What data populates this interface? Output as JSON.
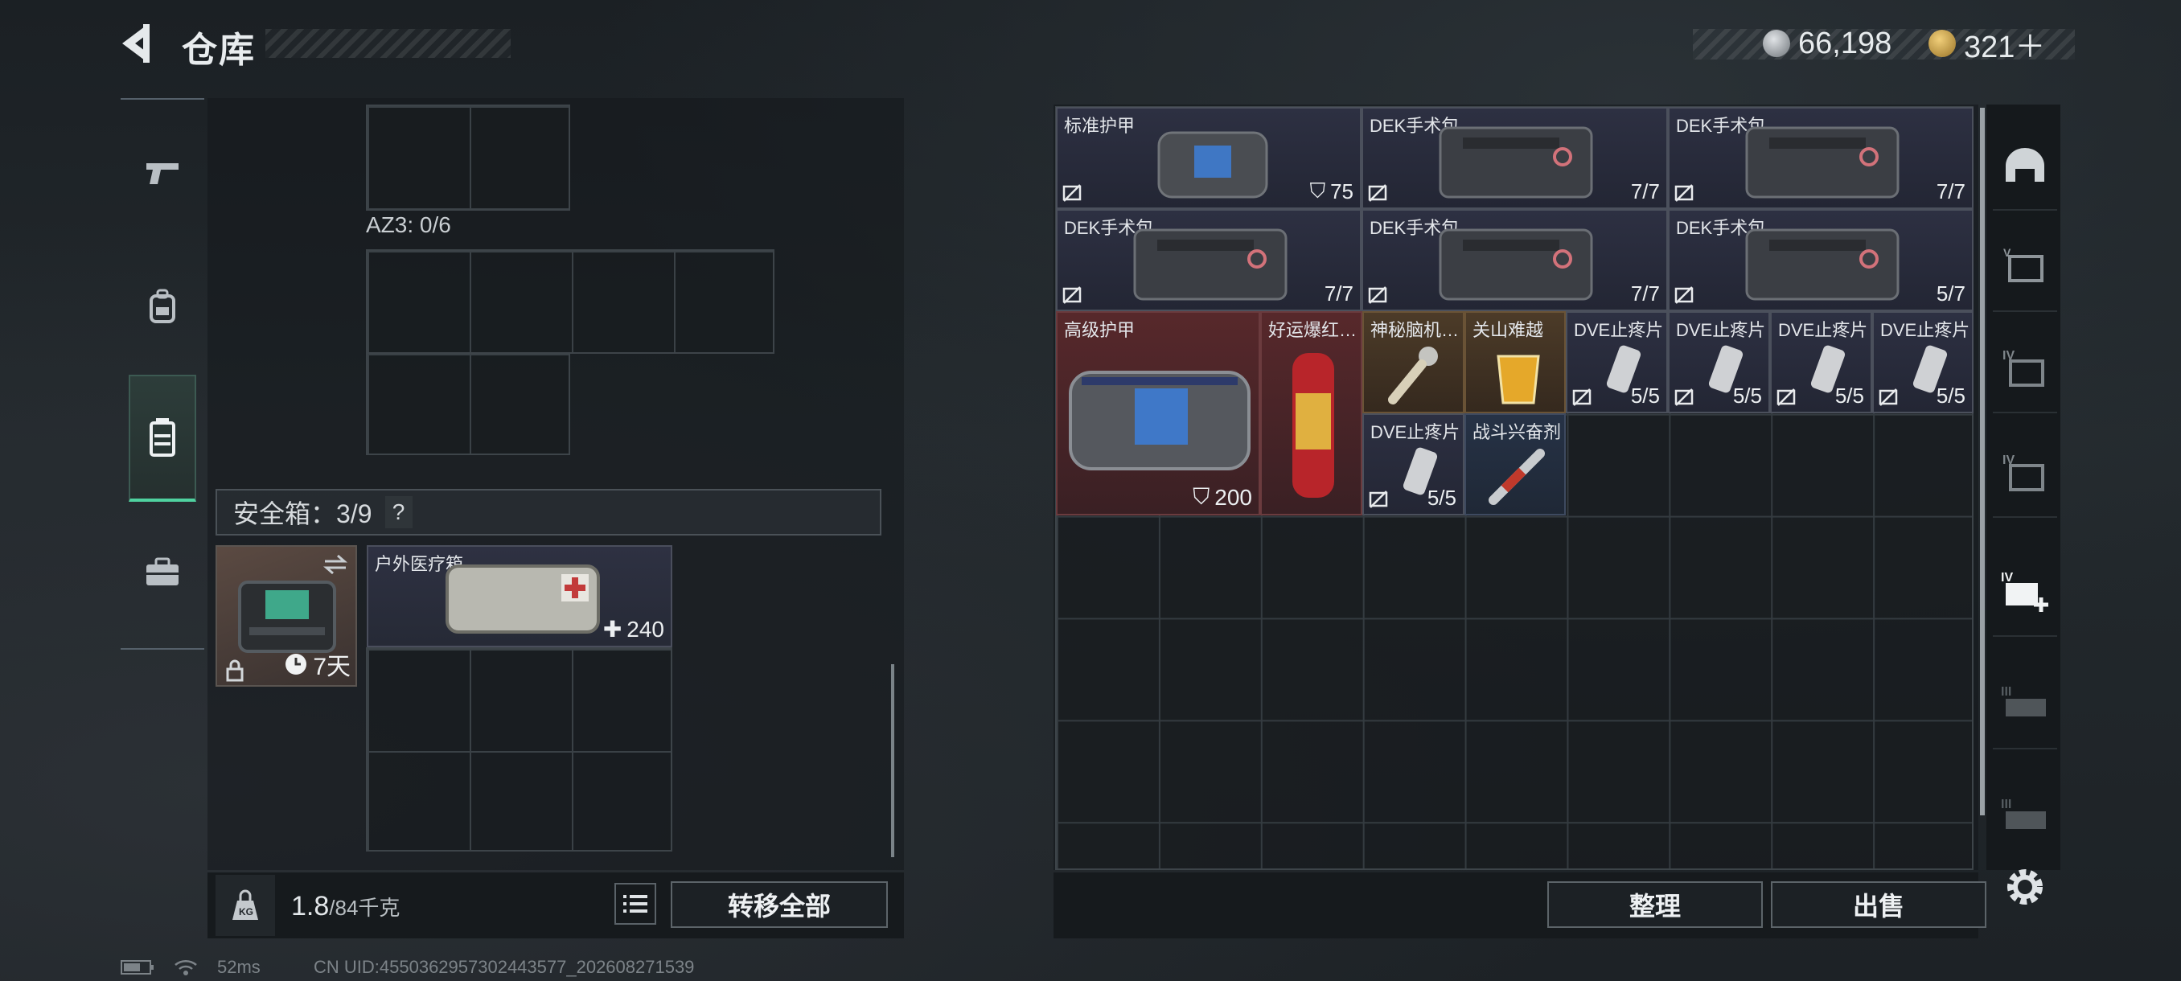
{
  "header": {
    "title": "仓库",
    "currency": [
      {
        "icon": "silver-coin-icon",
        "value": "66,198"
      },
      {
        "icon": "gold-triangle-coin-icon",
        "value": "321＋"
      }
    ]
  },
  "left_nav": [
    {
      "icon": "pistol-icon",
      "active": false
    },
    {
      "icon": "backpack-icon",
      "active": false
    },
    {
      "icon": "vest-icon",
      "active": true
    },
    {
      "icon": "briefcase-icon",
      "active": false
    }
  ],
  "left_panel": {
    "az3_label": "AZ3: 0/6",
    "safebox_label": "安全箱：3/9",
    "safebox_help": "?",
    "safebox_item": {
      "duration": "7天"
    },
    "medkit_item": {
      "name": "户外医疗箱",
      "value": "240"
    }
  },
  "footer_left": {
    "weight_current": "1.8",
    "weight_max": "/84千克",
    "transfer_all": "转移全部"
  },
  "items": [
    {
      "name": "标准护甲",
      "value": "75",
      "type": "armor"
    },
    {
      "name": "DEK手术包",
      "value": "7/7",
      "type": "kit"
    },
    {
      "name": "DEK手术包",
      "value": "7/7",
      "type": "kit"
    },
    {
      "name": "DEK手术包",
      "value": "7/7",
      "type": "kit"
    },
    {
      "name": "DEK手术包",
      "value": "7/7",
      "type": "kit"
    },
    {
      "name": "DEK手术包",
      "value": "5/7",
      "type": "kit"
    },
    {
      "name": "高级护甲",
      "value": "200",
      "type": "armor"
    },
    {
      "name": "好运爆红…",
      "value": "",
      "type": "misc"
    },
    {
      "name": "神秘脑机…",
      "value": "",
      "type": "misc"
    },
    {
      "name": "关山难越",
      "value": "",
      "type": "misc"
    },
    {
      "name": "DVE止疼片",
      "value": "5/5",
      "type": "pill"
    },
    {
      "name": "DVE止疼片",
      "value": "5/5",
      "type": "pill"
    },
    {
      "name": "DVE止疼片",
      "value": "5/5",
      "type": "pill"
    },
    {
      "name": "DVE止疼片",
      "value": "5/5",
      "type": "pill"
    },
    {
      "name": "DVE止疼片",
      "value": "5/5",
      "type": "pill"
    },
    {
      "name": "战斗兴奋剂",
      "value": "",
      "type": "injector"
    }
  ],
  "footer_right": {
    "tidy": "整理",
    "sell": "出售"
  },
  "right_nav": [
    {
      "icon": "helmet-icon"
    },
    {
      "icon": "armor-filter-icon"
    },
    {
      "icon": "tier-iv-ammo-icon",
      "label": "IV"
    },
    {
      "icon": "tier-iv-ammo-icon-2",
      "label": "IV"
    },
    {
      "icon": "tier-iv-medkit-icon",
      "label": "IV"
    },
    {
      "icon": "tier-iii-ammo-icon",
      "label": "III"
    },
    {
      "icon": "tier-iii-ammo-icon-2",
      "label": "III"
    }
  ],
  "status": {
    "ping": "52ms",
    "uid": "CN UID:4550362957302443577_202608271539"
  },
  "colors": {
    "accent_green": "#4fd2a0",
    "armor_red": "#57282b",
    "item_blue": "#2d3042"
  }
}
